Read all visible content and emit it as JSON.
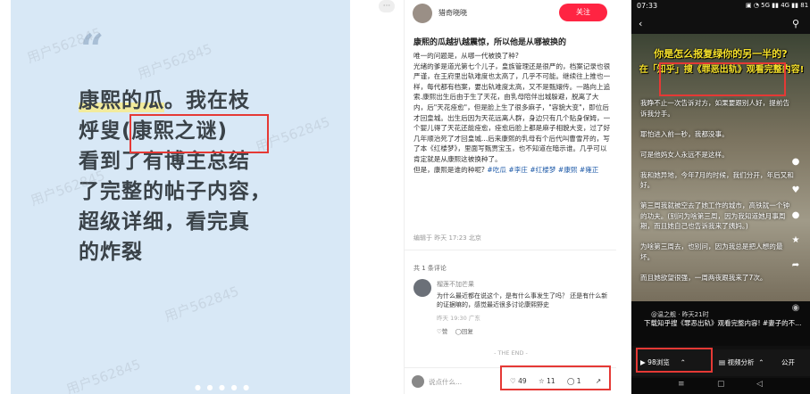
{
  "left": {
    "quote_mark": "“",
    "line1_hl": "康熙的瓜",
    "line1_rest": "。我在枝",
    "line2": "烀叟(康熙之谜)",
    "line3": "看到了有博主总结",
    "line4": "了完整的帖子内容，",
    "line5": "超级详细，看完真",
    "line6": "的炸裂",
    "dots": "● ● ● ● ●"
  },
  "watermark": "用户562845",
  "middle": {
    "author": "猎奇晓晓",
    "follow_label": "关注",
    "close_label": "···",
    "title": "康熙的瓜越扒越震惊，所以他是从哪被换的",
    "body": "唯一的问题是，从哪一代被换了种?\n光绪的爹是道光第七个儿子，皇族管理还是很严的，档案记录也很严谨，在王府里出轨难度也太高了，几乎不可能。继续往上推也一样，每代都有档案，要出轨难度太高，又不是甄嬛传。一路向上追索.康熙出生后由于生了天花，由乳母陪伴出城躲避，脱离了大内，后\"天花痊愈\"，但是脸上生了很多麻子，\"容貌大变\"，即位后才回皇城。出生后因为天花远离人群，身边只有几个贴身保姆，一个婴儿得了天花还能痊愈，痊愈后脸上都是麻子相貌大变，过了好几年顺治死了才回皇城...后来康熙的乳母有个后代叫曹雪芹的，写了本《红楼梦》，里面写甄贾宝玉，也不知道在暗示谁。几乎可以肯定就是从康熙这被换种了。\n但是，康熙是谁的种呢? ",
    "tags": "#吃瓜 #李庄 #红楼梦 #康熙 #雍正",
    "edited": "编辑于 昨天 17:23 北京",
    "comment_count": "共 1 条评论",
    "comment": {
      "name": "榴莲不加芒果",
      "text": "为什么最近都在说这个，是有什么事发生了吗？ 还是有什么新的证据嘛的，感觉最近很多讨论康熙野史",
      "meta": "昨天 19:30 广东",
      "like": "♡赞",
      "reply": "◯回复"
    },
    "the_end": "- THE END -",
    "input_placeholder": "说点什么...",
    "likes": "49",
    "stars": "11",
    "comments": "1"
  },
  "right": {
    "time": "07:33",
    "status_icons": "▣ ◔ 5G ▮▮ 4G ▮▮ 81",
    "headline1": "你是怎么报复绿你的另一半的?",
    "headline2": "在「知乎」搜《罪恶出轨》观看完整内容!",
    "text": "我睁不止一次告诉对方，如果要跟别人好，提前告诉我分手。\n\n耶怕进入前一秒，我都没事。\n\n可是他妈女人永远不是这样。\n\n我和她异地，今年7月的时候，我们分开，年后又和好。\n\n第三周我就被空去了她工作的城市，高铁就一个钟的功夫。(别问为啥第三周，因为我知道她月事周期，而且她自己也告诉我来了姨妈。)\n\n为啥第三周去，也别问，因为我总是把人想的最坏。\n\n而且她欲望很强，一周两夜跟我来了7次。",
    "caption_user": "@温之舰 · 昨天21时",
    "caption": "下载知乎搜《罪恶出轨》观看完整内容! #妻子的不...",
    "views": "98浏览",
    "analysis": "视频分析",
    "public": "公开",
    "side_counts": [
      "",
      "",
      "1",
      ""
    ]
  }
}
